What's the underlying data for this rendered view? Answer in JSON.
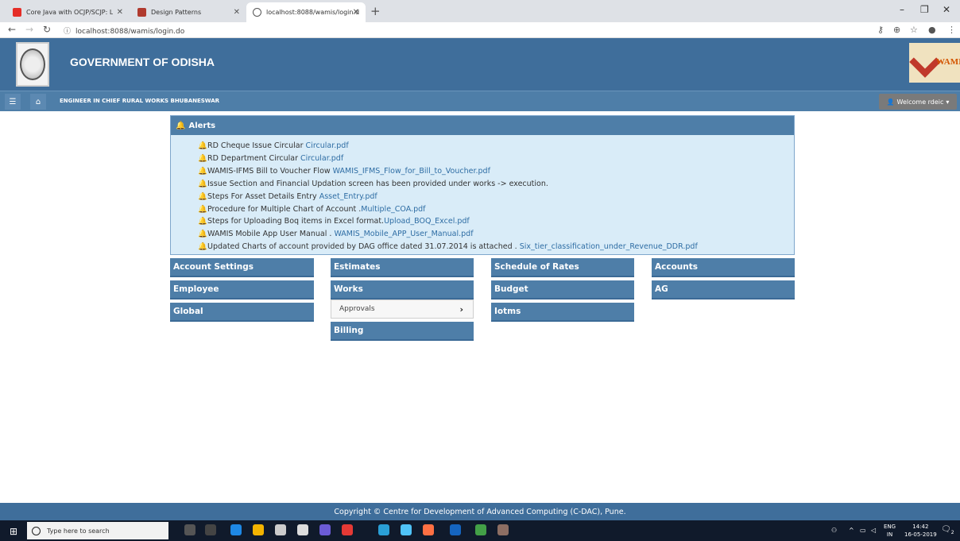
{
  "browser": {
    "tabs": [
      {
        "title": "Core Java with OCJP/SCJP: L"
      },
      {
        "title": "Design Patterns"
      },
      {
        "title": "localhost:8088/wamis/login.do"
      }
    ],
    "address": "localhost:8088/wamis/login.do"
  },
  "header": {
    "brand": "GOVERNMENT OF ODISHA",
    "logo_text": "WAMIS",
    "office": "ENGINEER IN CHIEF RURAL WORKS BHUBANESWAR",
    "welcome": "Welcome rdeic"
  },
  "alerts": {
    "title": "Alerts",
    "items": [
      {
        "text": "RD Cheque Issue Circular ",
        "link": "Circular.pdf",
        "color": "#e02424"
      },
      {
        "text": "RD Department Circular ",
        "link": "Circular.pdf",
        "color": "#e02424"
      },
      {
        "text": "WAMIS-IFMS Bill to Voucher Flow ",
        "link": "WAMIS_IFMS_Flow_for_Bill_to_Voucher.pdf",
        "color": "#e02424"
      },
      {
        "text": "Issue Section and Financial Updation screen has been provided under works -> execution.",
        "link": "",
        "color": "#e02424"
      },
      {
        "text": "Steps For Asset Details Entry ",
        "link": "Asset_Entry.pdf",
        "color": "#555555"
      },
      {
        "text": "Procedure for Multiple Chart of Account .",
        "link": "Multiple_COA.pdf",
        "color": "#555555"
      },
      {
        "text": "Steps for Uploading Boq items in Excel format.",
        "link": "Upload_BOQ_Excel.pdf",
        "color": "#555555"
      },
      {
        "text": "WAMIS Mobile App User Manual . ",
        "link": "WAMIS_Mobile_APP_User_Manual.pdf",
        "color": "#555555"
      },
      {
        "text": "Updated Charts of account provided by DAG office dated 31.07.2014 is attached . ",
        "link": "Six_tier_classification_under_Revenue_DDR.pdf",
        "color": "#555555"
      }
    ]
  },
  "menu": {
    "account_settings": "Account Settings",
    "employee": "Employee",
    "global": "Global",
    "estimates": "Estimates",
    "works": "Works",
    "approvals": "Approvals",
    "billing": "Billing",
    "schedule_of_rates": "Schedule of Rates",
    "budget": "Budget",
    "iotms": "Iotms",
    "accounts": "Accounts",
    "ag": "AG"
  },
  "footer": {
    "copyright": "Copyright © Centre for Development of Advanced Computing (C-DAC), Pune."
  },
  "taskbar": {
    "search_placeholder": "Type here to search",
    "lang": "ENG",
    "region": "IN",
    "time": "14:42",
    "date": "16-05-2019",
    "notifications": "2"
  }
}
